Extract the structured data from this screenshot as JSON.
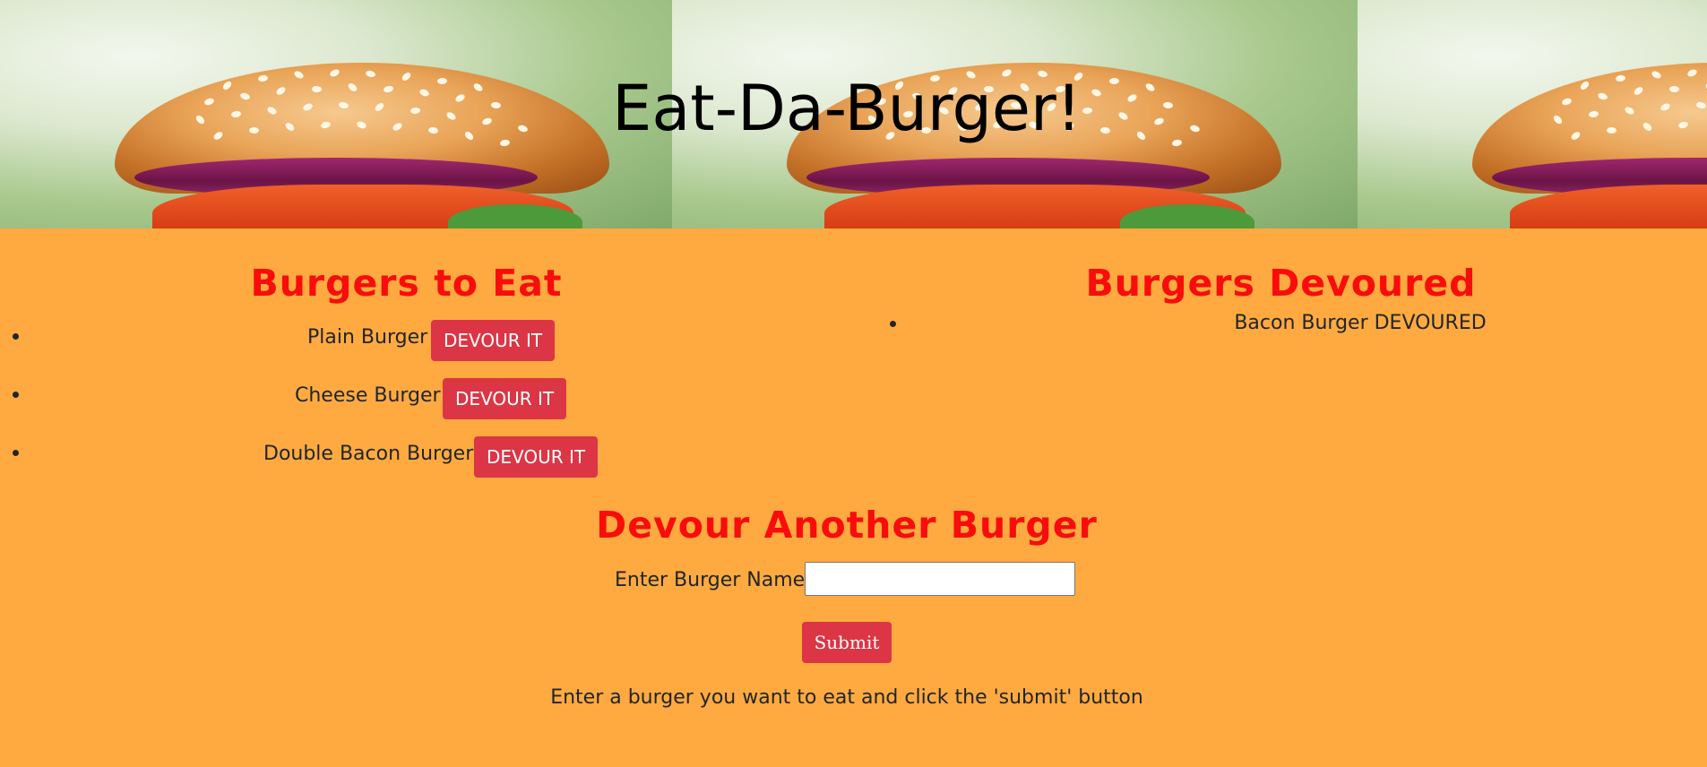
{
  "header": {
    "title": "Eat-Da-Burger!"
  },
  "to_eat": {
    "heading": "Burgers to Eat",
    "button_label": "DEVOUR IT",
    "items": [
      {
        "name": "Plain Burger"
      },
      {
        "name": "Cheese Burger"
      },
      {
        "name": "Double Bacon Burger"
      }
    ]
  },
  "devoured": {
    "heading": "Burgers Devoured",
    "items": [
      {
        "text": "Bacon Burger DEVOURED"
      }
    ]
  },
  "form": {
    "heading": "Devour Another Burger",
    "label": "Enter Burger Name",
    "input_value": "",
    "submit_label": "Submit",
    "hint": "Enter a burger you want to eat and click the 'submit' button"
  },
  "colors": {
    "page_background": "#ffaa40",
    "heading_red": "#f90c0c",
    "button_red": "#dc3545"
  }
}
